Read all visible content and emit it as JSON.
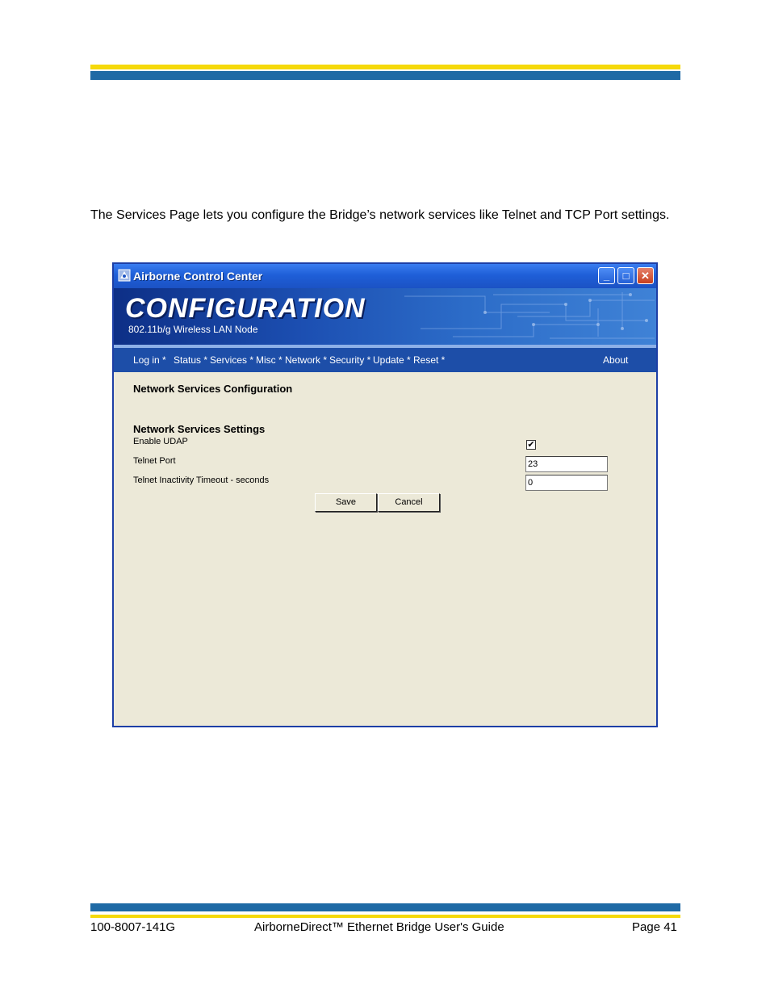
{
  "intro_text": "The Services Page lets you configure the Bridge’s network services like Telnet and TCP Port settings.",
  "window": {
    "title": "Airborne Control Center",
    "banner_title": "CONFIGURATION",
    "banner_subtitle": "802.11b/g Wireless LAN Node",
    "controls": {
      "minimize": "_",
      "maximize": "□",
      "close": "✕"
    }
  },
  "nav": {
    "items": [
      "Log in *",
      "Status *",
      "Services *",
      "Misc *",
      "Network *",
      "Security *",
      "Update *",
      "Reset *"
    ],
    "about": "About"
  },
  "content": {
    "page_title": "Network Services Configuration",
    "section_title": "Network Services Settings",
    "enable_udap": {
      "label": "Enable UDAP",
      "checked": true,
      "mark": "✔"
    },
    "telnet_port": {
      "label": "Telnet Port",
      "value": "23"
    },
    "telnet_timeout": {
      "label": "Telnet Inactivity Timeout - seconds",
      "value": "0"
    },
    "save_label": "Save",
    "cancel_label": "Cancel"
  },
  "footer": {
    "doc_number": "100-8007-141G",
    "doc_title": "AirborneDirect™ Ethernet Bridge User's Guide",
    "page": "Page 41"
  },
  "colors": {
    "header_yellow": "#f5d90a",
    "header_blue": "#1f6aa5",
    "window_border": "#1d3fa6",
    "nav_bg": "#1d4ea8",
    "panel_bg": "#ece9d8"
  }
}
